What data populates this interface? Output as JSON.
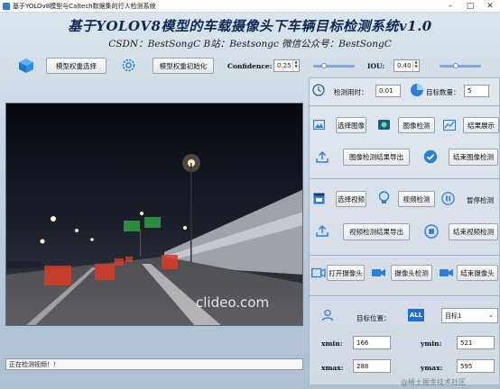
{
  "window": {
    "title": "基于YOLOv8模型与Caltech数据集的行人检测系统",
    "minimize": "–",
    "maximize": "□",
    "close": "✕"
  },
  "header": {
    "title": "基于YOLOV8模型的车载摄像头下车辆目标检测系统v1.0",
    "subtitle": "CSDN：BestSongC    B站：Bestsongc    微信公众号：BestSongC"
  },
  "toolbar": {
    "model_select_label": "模型权重选择",
    "model_init_label": "模型权重初始化",
    "confidence_label": "Confidence:",
    "confidence_value": "0.25",
    "confidence_level": 0.25,
    "iou_label": "IOU:",
    "iou_value": "0.40",
    "iou_level": 0.4
  },
  "stats": {
    "time_label": "检测用时：",
    "time_value": "0.01",
    "count_label": "目标数量：",
    "count_value": "5"
  },
  "image_section": {
    "select_label": "选择图像",
    "detect_label": "图像检测",
    "show_label": "结果展示",
    "export_label": "图像检测结果导出",
    "end_label": "结束图像检测"
  },
  "video_section": {
    "select_label": "选择视频",
    "detect_label": "视频检测",
    "pause_label": "暂停检测",
    "export_label": "视频检测结果导出",
    "end_label": "结束视频检测"
  },
  "camera_section": {
    "open_label": "打开摄像头",
    "detect_label": "摄像头检测",
    "end_label": "结束摄像头"
  },
  "target": {
    "position_label": "目标位置：",
    "all_badge": "ALL",
    "select_value": "目标1",
    "xmin_label": "xmin:",
    "xmin_value": "166",
    "ymin_label": "ymin:",
    "ymin_value": "521",
    "xmax_label": "xmax:",
    "xmax_value": "288",
    "ymax_label": "ymax:",
    "ymax_value": "595"
  },
  "video_view": {
    "watermark": "clideo.com"
  },
  "status": {
    "text": "正在检测视频！！"
  },
  "footer": {
    "watermark": "@稀土掘金技术社区"
  },
  "colors": {
    "accent": "#2b7fd4",
    "title": "#0d2a55"
  }
}
